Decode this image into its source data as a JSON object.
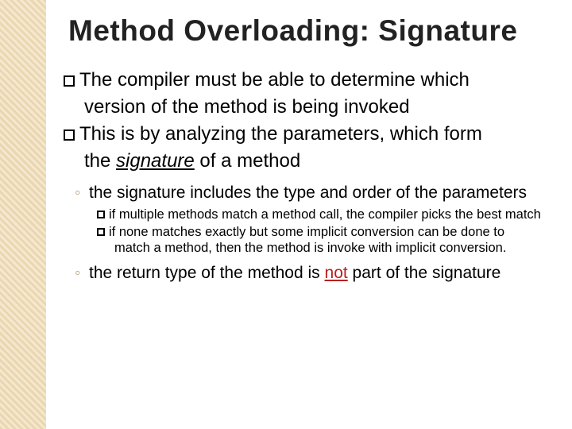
{
  "title": "Method Overloading: Signature",
  "bullets": {
    "p1a": "The compiler must be able to determine which",
    "p1b": "version of the method is being invoked",
    "p2a": "This is by analyzing the parameters, which form",
    "p2b_pre": "the ",
    "p2b_sig": "signature",
    "p2b_post": " of a method"
  },
  "sub": {
    "s1": "the signature includes the type and order of the parameters",
    "s1_children": {
      "c1": "if multiple methods match a method call, the compiler picks the best match",
      "c2": "if none matches exactly but some implicit conversion can be done to match a method, then the method is invoke with implicit conversion."
    },
    "s2_pre": "the return type of the method is ",
    "s2_not": "not",
    "s2_post": " part of the signature"
  },
  "chart_data": null
}
